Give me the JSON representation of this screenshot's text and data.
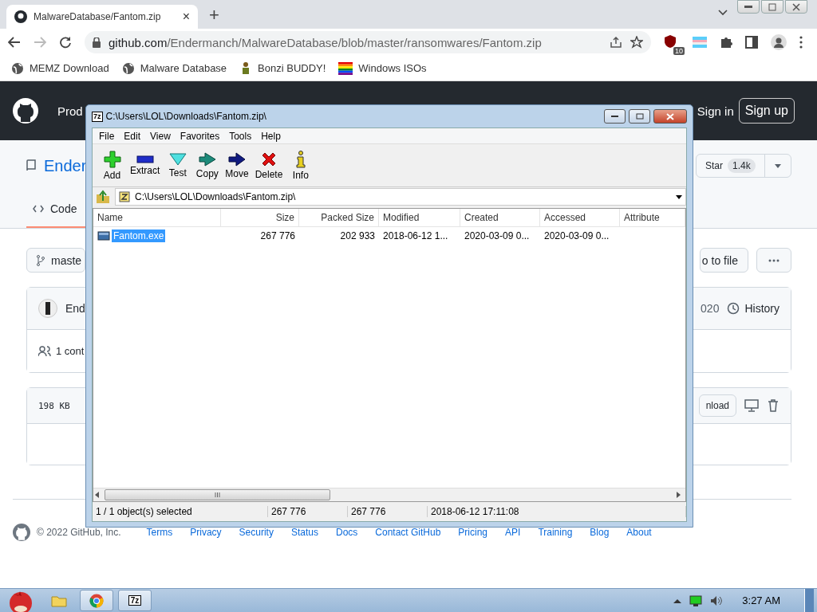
{
  "browser": {
    "tab": {
      "title": "MalwareDatabase/Fantom.zip",
      "close": "×"
    },
    "new_tab": "+",
    "address": {
      "host": "github.com",
      "path": "/Endermanch/MalwareDatabase/blob/master/ransomwares/Fantom.zip"
    },
    "extension_badge": "10",
    "bookmarks": [
      {
        "label": "MEMZ Download",
        "kind": "globe"
      },
      {
        "label": "Malware Database",
        "kind": "globe"
      },
      {
        "label": "Bonzi BUDDY!",
        "kind": "figure"
      },
      {
        "label": "Windows ISOs",
        "kind": "flag"
      }
    ]
  },
  "github": {
    "header": {
      "nav": "Prod",
      "sign_in": "Sign in",
      "sign_up": "Sign up"
    },
    "repo": {
      "name": "Ender",
      "star": "Star",
      "star_count": "1.4k"
    },
    "tabs": [
      {
        "label": "Code",
        "selected": true
      }
    ],
    "branch": "maste",
    "go_to_file": "o to file",
    "commit": {
      "author": "End",
      "date": "020",
      "history": "History",
      "contributors": "1 cont"
    },
    "file": {
      "size": "198 KB",
      "download": "nload"
    },
    "footer": {
      "copyright": "© 2022 GitHub, Inc.",
      "links": [
        "Terms",
        "Privacy",
        "Security",
        "Status",
        "Docs",
        "Contact GitHub",
        "Pricing",
        "API",
        "Training",
        "Blog",
        "About"
      ]
    }
  },
  "archive_window": {
    "app_icon": "7z",
    "title": "C:\\Users\\LOL\\Downloads\\Fantom.zip\\",
    "menu": [
      "File",
      "Edit",
      "View",
      "Favorites",
      "Tools",
      "Help"
    ],
    "toolbar": [
      {
        "label": "Add",
        "kind": "add"
      },
      {
        "label": "Extract",
        "kind": "extract"
      },
      {
        "label": "Test",
        "kind": "test"
      },
      {
        "label": "Copy",
        "kind": "copy"
      },
      {
        "label": "Move",
        "kind": "move"
      },
      {
        "label": "Delete",
        "kind": "delete"
      },
      {
        "label": "Info",
        "kind": "info"
      }
    ],
    "path": "C:\\Users\\LOL\\Downloads\\Fantom.zip\\",
    "columns": [
      "Name",
      "Size",
      "Packed Size",
      "Modified",
      "Created",
      "Accessed",
      "Attribute"
    ],
    "rows": [
      {
        "cells": [
          "Fantom.exe",
          "267 776",
          "202 933",
          "2018-06-12 1...",
          "2020-03-09 0...",
          "2020-03-09 0..."
        ],
        "selected": true
      }
    ],
    "status": [
      "1 / 1 object(s) selected",
      "267 776",
      "267 776",
      "2018-06-12 17:11:08"
    ]
  },
  "taskbar": {
    "apps": [
      {
        "kind": "folder",
        "selected": false
      },
      {
        "kind": "chrome",
        "selected": true
      },
      {
        "kind": "archiver",
        "label": "7z",
        "selected": true
      }
    ],
    "clock": "3:27 AM"
  }
}
